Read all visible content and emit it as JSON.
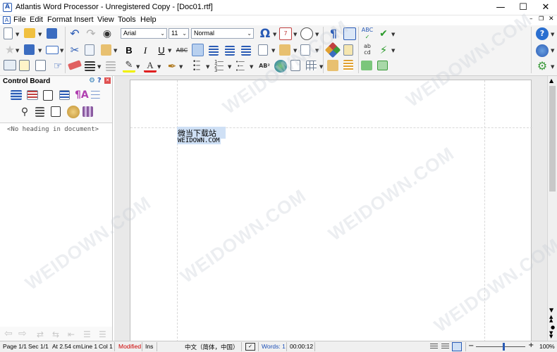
{
  "window": {
    "title": "Atlantis Word Processor - Unregistered Copy - [Doc01.rtf]",
    "app_icon": "A"
  },
  "menu": [
    "File",
    "Edit",
    "Format",
    "Insert",
    "View",
    "Tools",
    "Help"
  ],
  "toolbar": {
    "font": "Arial",
    "size": "11",
    "style": "Normal"
  },
  "control_board": {
    "title": "Control Board",
    "empty_message": "<No heading in document>"
  },
  "document": {
    "line1": "微当下载站",
    "line2": "WEIDOWN.COM"
  },
  "watermark": "WEIDOWN.COM",
  "status": {
    "page": "Page 1/1",
    "sec": "Sec 1/1",
    "at": "At 2.54 cm",
    "line": "Line 1",
    "col": "Col 1",
    "modified": "Modified",
    "ins": "Ins",
    "lang": "中文（简体，中国）",
    "words": "Words: 1",
    "time": "00:00:12",
    "zoom": "100%",
    "zoom_level": 0.55
  },
  "colors": {
    "accent": "#2a5bb5",
    "modified": "#cc0000",
    "words": "#1b4fb8",
    "selection": "#cfe0f5"
  }
}
